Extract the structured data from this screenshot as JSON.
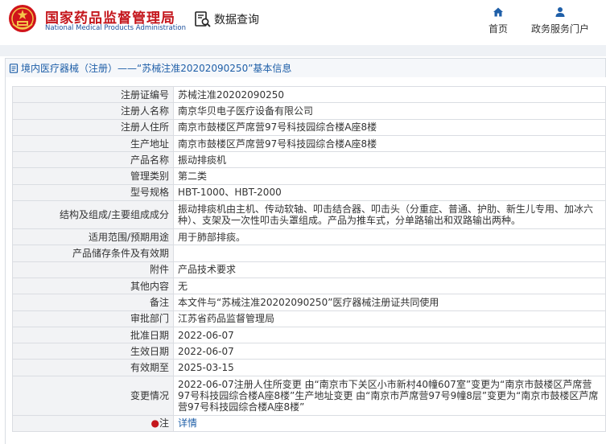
{
  "header": {
    "brand_cn": "国家药品监督管理局",
    "brand_en": "National Medical Products Administration",
    "search_label": "数据查询",
    "nav": [
      {
        "label": "首页",
        "icon": "home-icon"
      },
      {
        "label": "政务服务门户",
        "icon": "user-icon"
      }
    ],
    "colors": {
      "brand_red": "#c4161c",
      "brand_blue": "#1b4f9c",
      "nav_icon": "#1f5fa8"
    }
  },
  "breadcrumb": {
    "text": "境内医疗器械（注册）——“苏械注准20202090250”基本信息"
  },
  "details": {
    "rows": [
      {
        "key": "注册证编号",
        "value": "苏械注准20202090250"
      },
      {
        "key": "注册人名称",
        "value": "南京华贝电子医疗设备有限公司"
      },
      {
        "key": "注册人住所",
        "value": "南京市鼓楼区芦席营97号科技园综合楼A座8楼"
      },
      {
        "key": "生产地址",
        "value": "南京市鼓楼区芦席营97号科技园综合楼A座8楼"
      },
      {
        "key": "产品名称",
        "value": "振动排痰机"
      },
      {
        "key": "管理类别",
        "value": "第二类"
      },
      {
        "key": "型号规格",
        "value": "HBT-1000、HBT-2000"
      },
      {
        "key": "结构及组成/主要组成成分",
        "value": "振动排痰机由主机、传动软轴、叩击结合器、叩击头（分重症、普通、护肋、新生儿专用、加冰六种）、支架及一次性叩击头罩组成。产品为推车式，分单路输出和双路输出两种。"
      },
      {
        "key": "适用范围/预期用途",
        "value": "用于肺部排痰。"
      },
      {
        "key": "产品储存条件及有效期",
        "value": ""
      },
      {
        "key": "附件",
        "value": "产品技术要求"
      },
      {
        "key": "其他内容",
        "value": "无"
      },
      {
        "key": "备注",
        "value": "本文件与“苏械注准20202090250”医疗器械注册证共同使用"
      },
      {
        "key": "审批部门",
        "value": "江苏省药品监督管理局"
      },
      {
        "key": "批准日期",
        "value": "2022-06-07"
      },
      {
        "key": "生效日期",
        "value": "2022-06-07"
      },
      {
        "key": "有效期至",
        "value": "2025-03-15"
      },
      {
        "key": "变更情况",
        "value": "2022-06-07注册人住所变更 由“南京市下关区小市新村40幢607室”变更为“南京市鼓楼区芦席营97号科技园综合楼A座8楼”生产地址变更 由“南京市芦席营97号9幢8层”变更为“南京市鼓楼区芦席营97号科技园综合楼A座8楼”"
      }
    ],
    "note": {
      "key_marker": "●",
      "key": "注",
      "link": "详情"
    }
  }
}
